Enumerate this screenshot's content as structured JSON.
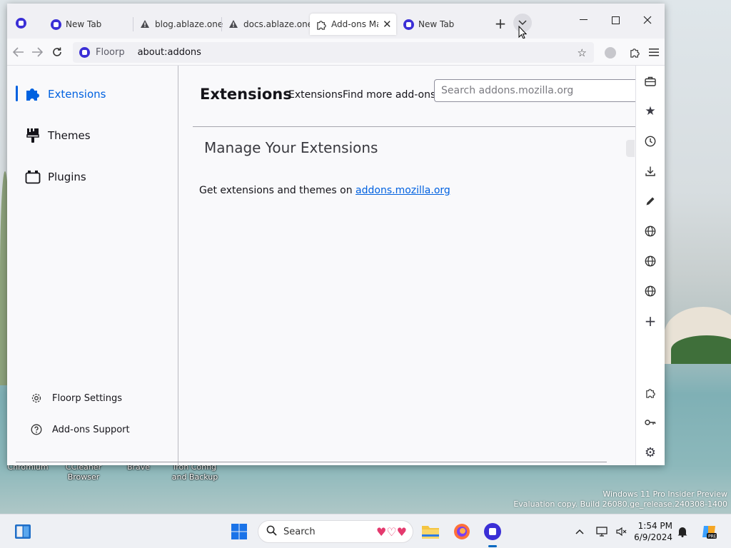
{
  "desktop": {
    "icon_labels": [
      "Chromium",
      "CCleaner Browser",
      "Brave",
      "Iron Config and Backup"
    ],
    "watermark_line1": "Windows 11 Pro Insider Preview",
    "watermark_line2": "Evaluation copy. Build 26080.ge_release.240308-1400"
  },
  "tabs": [
    {
      "label": "New Tab",
      "icon": "floorp-icon",
      "active": false
    },
    {
      "label": "blog.ablaze.one",
      "icon": "warning-icon",
      "active": false
    },
    {
      "label": "docs.ablaze.one",
      "icon": "warning-icon",
      "active": false
    },
    {
      "label": "Add-ons Manager",
      "icon": "puzzle-icon",
      "active": true
    },
    {
      "label": "New Tab",
      "icon": "floorp-icon",
      "active": false
    }
  ],
  "urlbar": {
    "identity_label": "Floorp",
    "url": "about:addons"
  },
  "addons": {
    "categories": [
      {
        "label": "Extensions",
        "icon": "puzzle-icon",
        "selected": true
      },
      {
        "label": "Themes",
        "icon": "paintbrush-icon",
        "selected": false
      },
      {
        "label": "Plugins",
        "icon": "plugin-icon",
        "selected": false
      }
    ],
    "footer_links": [
      {
        "label": "Floorp Settings",
        "icon": "gear-icon"
      },
      {
        "label": "Add-ons Support",
        "icon": "help-icon"
      }
    ],
    "heading": "Extensions",
    "header_sub": "ExtensionsFind more add-ons",
    "search_placeholder": "Search addons.mozilla.org",
    "manage_title": "Manage Your Extensions",
    "get_text": "Get extensions and themes on ",
    "get_link": "addons.mozilla.org"
  },
  "taskbar": {
    "search_placeholder": "Search",
    "time": "1:54 PM",
    "date": "6/9/2024"
  }
}
